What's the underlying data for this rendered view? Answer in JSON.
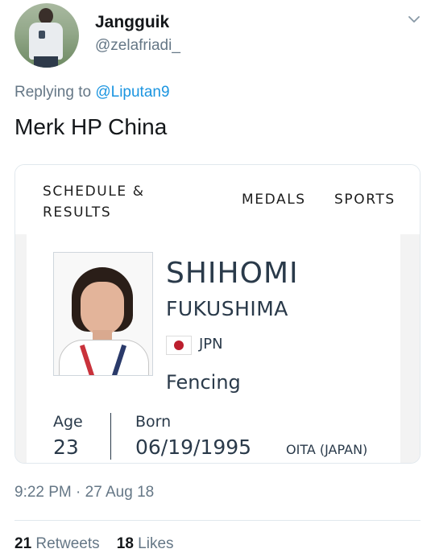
{
  "tweet": {
    "display_name": "Jangguik",
    "handle": "@zelafriadi_",
    "reply_prefix": "Replying to",
    "reply_mention": "@Liputan9",
    "text": "Merk HP China",
    "timestamp": "9:22 PM · 27 Aug 18",
    "stats": {
      "retweets_count": "21",
      "retweets_label": "Retweets",
      "likes_count": "18",
      "likes_label": "Likes"
    },
    "icons": {
      "more": "chevron-down-icon"
    }
  },
  "card": {
    "nav": {
      "schedule_line1": "SCHEDULE &",
      "schedule_line2": "RESULTS",
      "medals": "MEDALS",
      "sports": "SPORTS"
    },
    "athlete": {
      "first_name": "SHIHOMI",
      "last_name": "FUKUSHIMA",
      "country": "JPN",
      "sport": "Fencing",
      "age_label": "Age",
      "age": "23",
      "born_label": "Born",
      "born_date": "06/19/1995",
      "born_place": "OITA (JAPAN)"
    }
  },
  "colors": {
    "text_primary": "#14171a",
    "text_secondary": "#657786",
    "link": "#1b95e0",
    "card_text": "#2a3a4a",
    "flag_red": "#bc1e2d"
  }
}
